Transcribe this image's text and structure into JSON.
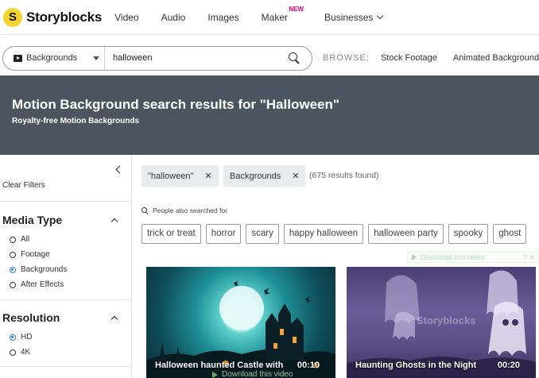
{
  "brand": {
    "name": "Storyblocks",
    "logo_letter": "S",
    "color": "#f6d330"
  },
  "nav": {
    "items": [
      {
        "label": "Video"
      },
      {
        "label": "Audio"
      },
      {
        "label": "Images"
      },
      {
        "label": "Maker",
        "badge": "NEW"
      },
      {
        "label": "Businesses"
      }
    ]
  },
  "search": {
    "type_label": "Backgrounds",
    "query": "halloween",
    "browse_label": "BROWSE:",
    "browse_links": [
      "Stock Footage",
      "Animated Backgrounds"
    ]
  },
  "hero": {
    "title": "Motion Background search results for \"Halloween\"",
    "subtitle": "Royalty-free Motion Backgrounds",
    "bg_color": "#4a5560"
  },
  "sidebar": {
    "clear_filters": "Clear Filters",
    "media_type": {
      "title": "Media Type",
      "options": [
        "All",
        "Footage",
        "Backgrounds",
        "After Effects"
      ],
      "selected": "Backgrounds"
    },
    "resolution": {
      "title": "Resolution",
      "options": [
        "HD",
        "4K"
      ],
      "selected": "HD"
    }
  },
  "filters": {
    "chips": [
      {
        "label": "\"halloween\""
      },
      {
        "label": "Backgrounds"
      }
    ],
    "results_count": "(675 results found)"
  },
  "suggestions": {
    "label": "People also searched for",
    "items": [
      "trick or treat",
      "horror",
      "scary",
      "happy halloween",
      "halloween party",
      "spooky",
      "ghost"
    ]
  },
  "download_label": "Download this video",
  "results": [
    {
      "title": "Halloween haunted Castle with",
      "duration": "00:10"
    },
    {
      "title": "Haunting Ghosts in the Night",
      "duration": "00:20",
      "watermark": "Storyblocks"
    }
  ],
  "colors": {
    "accent_radio": "#2f7dd6",
    "new_badge": "#d6006f"
  }
}
